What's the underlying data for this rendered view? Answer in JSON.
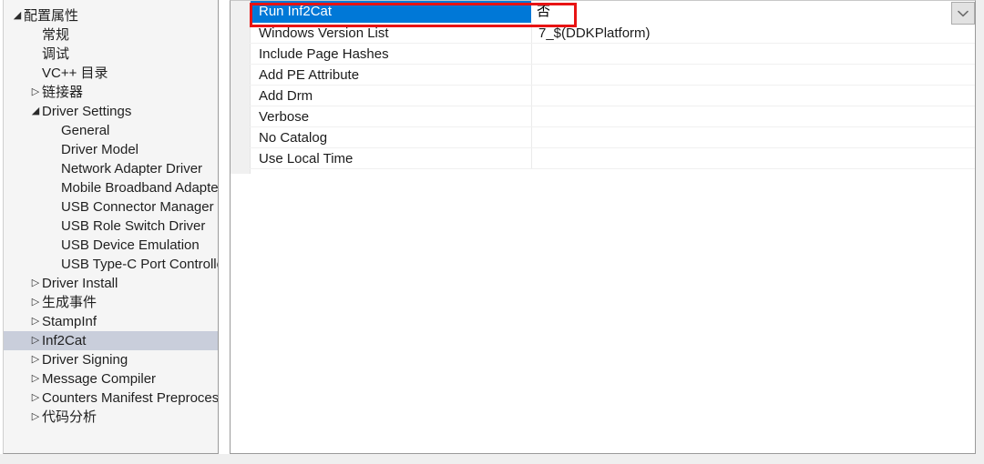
{
  "tree": {
    "name": "configuration-properties-tree",
    "selected_label": "Inf2Cat",
    "expander_glyphs": {
      "expanded": "◢",
      "collapsed": "▷",
      "leaf": ""
    },
    "items": [
      {
        "label": "配置属性",
        "level": 0,
        "state": "expanded",
        "selected": false
      },
      {
        "label": "常规",
        "level": 1,
        "state": "leaf",
        "selected": false
      },
      {
        "label": "调试",
        "level": 1,
        "state": "leaf",
        "selected": false
      },
      {
        "label": "VC++ 目录",
        "level": 1,
        "state": "leaf",
        "selected": false
      },
      {
        "label": "链接器",
        "level": 1,
        "state": "collapsed",
        "selected": false
      },
      {
        "label": "Driver Settings",
        "level": 1,
        "state": "expanded",
        "selected": false
      },
      {
        "label": "General",
        "level": 2,
        "state": "leaf",
        "selected": false
      },
      {
        "label": "Driver Model",
        "level": 2,
        "state": "leaf",
        "selected": false
      },
      {
        "label": "Network Adapter Driver",
        "level": 2,
        "state": "leaf",
        "selected": false
      },
      {
        "label": "Mobile Broadband Adapter",
        "level": 2,
        "state": "leaf",
        "selected": false
      },
      {
        "label": "USB Connector Manager",
        "level": 2,
        "state": "leaf",
        "selected": false
      },
      {
        "label": "USB Role Switch Driver",
        "level": 2,
        "state": "leaf",
        "selected": false
      },
      {
        "label": "USB Device Emulation",
        "level": 2,
        "state": "leaf",
        "selected": false
      },
      {
        "label": "USB Type-C Port Controller",
        "level": 2,
        "state": "leaf",
        "selected": false
      },
      {
        "label": "Driver Install",
        "level": 1,
        "state": "collapsed",
        "selected": false
      },
      {
        "label": "生成事件",
        "level": 1,
        "state": "collapsed",
        "selected": false
      },
      {
        "label": "StampInf",
        "level": 1,
        "state": "collapsed",
        "selected": false
      },
      {
        "label": "Inf2Cat",
        "level": 1,
        "state": "collapsed",
        "selected": true
      },
      {
        "label": "Driver Signing",
        "level": 1,
        "state": "collapsed",
        "selected": false
      },
      {
        "label": "Message Compiler",
        "level": 1,
        "state": "collapsed",
        "selected": false
      },
      {
        "label": "Counters Manifest Preprocessor",
        "level": 1,
        "state": "collapsed",
        "selected": false
      },
      {
        "label": "代码分析",
        "level": 1,
        "state": "collapsed",
        "selected": false
      }
    ]
  },
  "property_grid": {
    "name": "inf2cat-property-grid",
    "rows": [
      {
        "name": "Run Inf2Cat",
        "value": "否",
        "selected": true,
        "editing": true
      },
      {
        "name": "Windows Version List",
        "value": "7_$(DDKPlatform)",
        "selected": false,
        "editing": false
      },
      {
        "name": "Include Page Hashes",
        "value": "",
        "selected": false,
        "editing": false
      },
      {
        "name": "Add PE Attribute",
        "value": "",
        "selected": false,
        "editing": false
      },
      {
        "name": "Add Drm",
        "value": "",
        "selected": false,
        "editing": false
      },
      {
        "name": "Verbose",
        "value": "",
        "selected": false,
        "editing": false
      },
      {
        "name": "No Catalog",
        "value": "",
        "selected": false,
        "editing": false
      },
      {
        "name": "Use Local Time",
        "value": "",
        "selected": false,
        "editing": false
      }
    ],
    "editor": {
      "value": "否",
      "dropdown_icon": "chevron-down-icon"
    },
    "highlight": {
      "name": "red-annotation-box",
      "color": "#e81313"
    }
  },
  "colors": {
    "selection_blue": "#0078D7",
    "tree_selection": "#C9CEDB",
    "annotation_red": "#E81313",
    "panel_background": "#F5F5F5",
    "grid_background": "#FFFFFF"
  }
}
